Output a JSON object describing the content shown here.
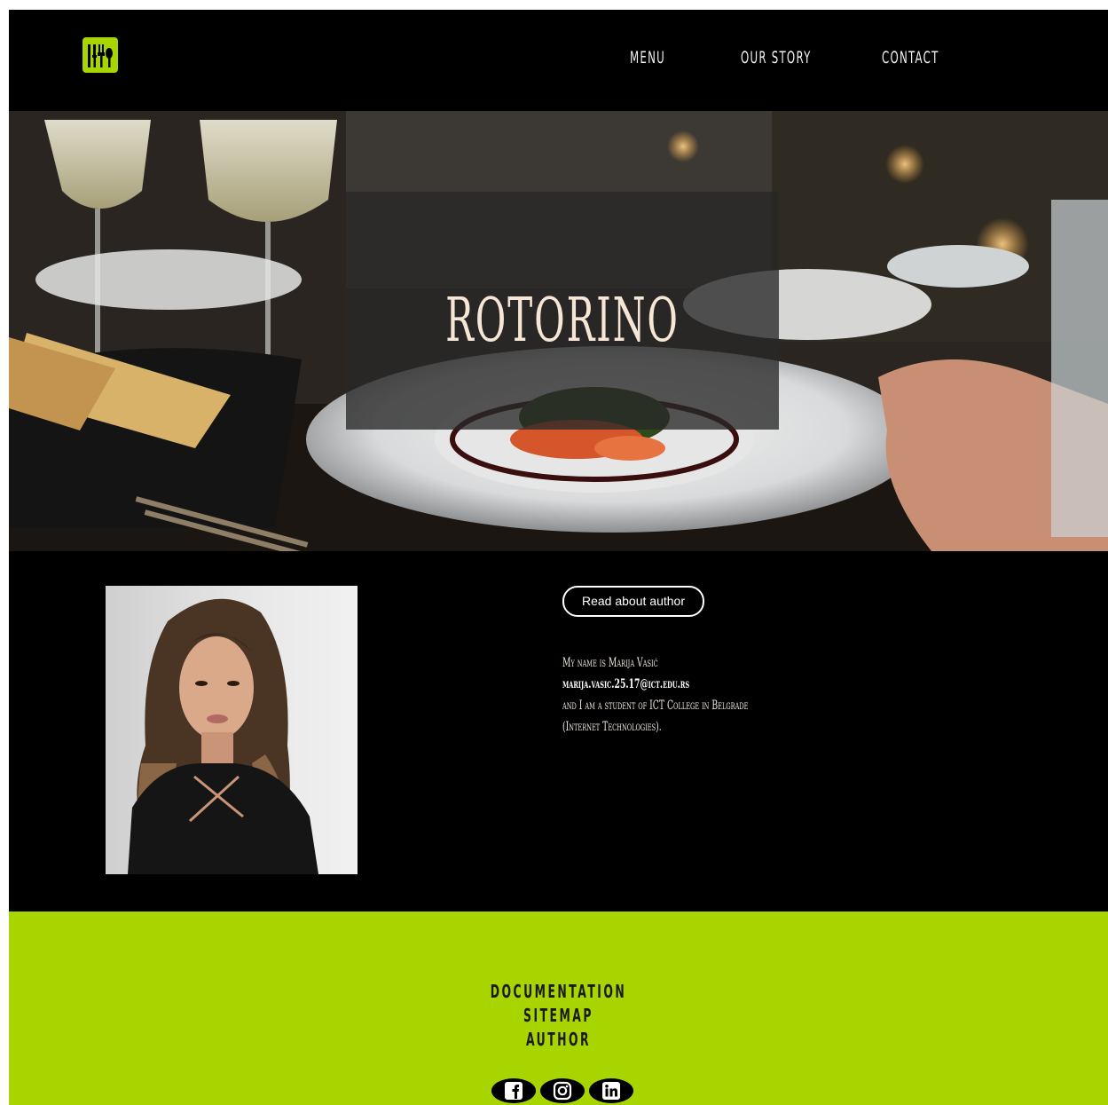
{
  "header": {
    "nav": [
      {
        "label": "MENU"
      },
      {
        "label": "OUR STORY"
      },
      {
        "label": "CONTACT"
      }
    ]
  },
  "hero": {
    "title": "ROTORINO"
  },
  "author": {
    "button_label": "Read about author",
    "bio": {
      "line1": "My name is Marija Vasić",
      "email": "marija.vasic.25.17@ict.edu.rs",
      "line3": "and I am a student of ICT College in Belgrade",
      "line4": "(Internet Technologies)."
    }
  },
  "footer": {
    "links": [
      {
        "label": "DOCUMENTATION"
      },
      {
        "label": "SITEMAP"
      },
      {
        "label": "AUTHOR"
      }
    ],
    "social": [
      {
        "icon": "facebook-icon"
      },
      {
        "icon": "instagram-icon"
      },
      {
        "icon": "linkedin-icon"
      }
    ]
  },
  "colors": {
    "accent": "#a8d400",
    "background": "#000000"
  }
}
